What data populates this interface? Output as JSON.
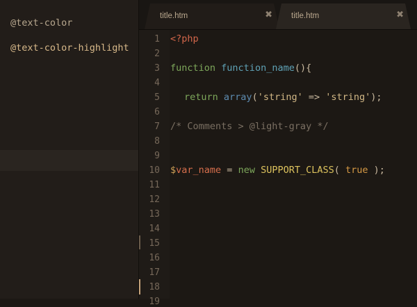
{
  "sidebar": {
    "items": [
      {
        "label": "@text-color"
      },
      {
        "label": "@text-color-highlight"
      }
    ]
  },
  "tabs": [
    {
      "label": "title.htm",
      "close": "✖"
    },
    {
      "label": "title.htm",
      "close": "✖"
    }
  ],
  "editor": {
    "line_numbers": [
      "1",
      "2",
      "3",
      "4",
      "5",
      "6",
      "7",
      "8",
      "9",
      "10",
      "11",
      "12",
      "13",
      "14",
      "15",
      "16",
      "17",
      "18",
      "19"
    ],
    "code": {
      "l1": {
        "php": "<?php"
      },
      "l3": {
        "kw": "function",
        "name": "function_name",
        "parens": "(){"
      },
      "l5": {
        "kw": "return",
        "fn": "array",
        "open": "(",
        "s1": "'string'",
        "arrow": " => ",
        "s2": "'string'",
        "close": ");"
      },
      "l7": {
        "comment": "/* Comments > @light-gray */"
      },
      "l10": {
        "dollar": "$",
        "var": "var_name",
        "eq": " = ",
        "new": "new",
        "cls": "SUPPORT_CLASS",
        "open": "( ",
        "bool": "true",
        "close": " );"
      }
    }
  },
  "colors": {
    "background": "#1c1814",
    "sidebar": "#221d19",
    "accent": "#c5a37b"
  }
}
